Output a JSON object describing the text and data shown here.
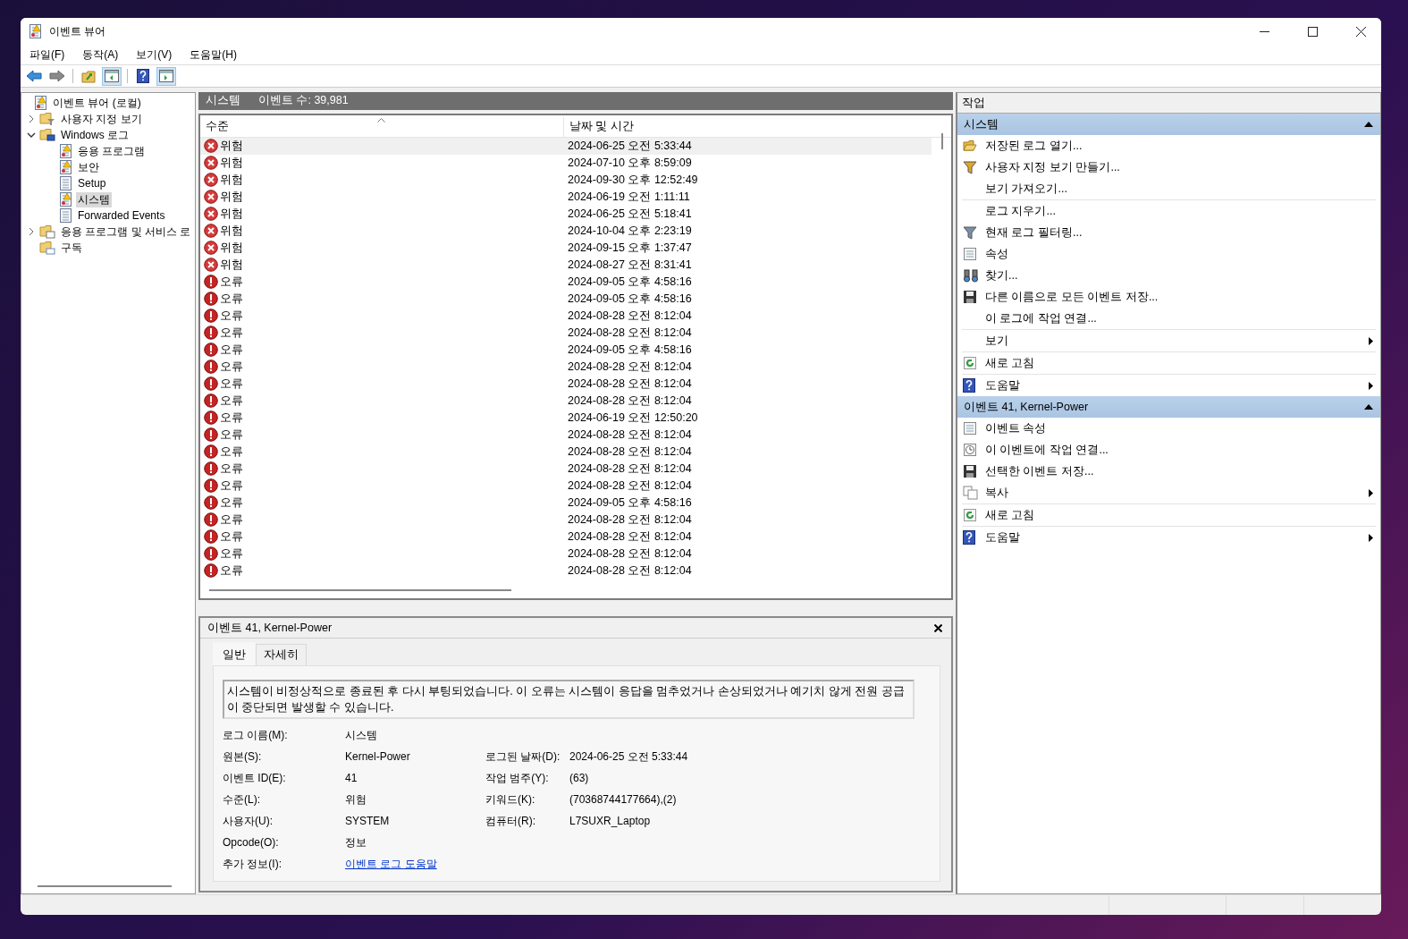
{
  "window": {
    "title": "이벤트 뷰어"
  },
  "menu": [
    "파일(F)",
    "동작(A)",
    "보기(V)",
    "도움말(H)"
  ],
  "toolbar": [
    {
      "kind": "back",
      "pressed": false
    },
    {
      "kind": "forward",
      "pressed": false
    },
    {
      "kind": "up",
      "pressed": false
    },
    {
      "kind": "tree",
      "pressed": true
    },
    {
      "kind": "help",
      "pressed": false
    },
    {
      "kind": "actions",
      "pressed": true
    }
  ],
  "tree": [
    {
      "label": "이벤트 뷰어 (로컬)",
      "kind": "root",
      "expandable": false,
      "selected": false,
      "children": [
        {
          "label": "사용자 지정 보기",
          "kind": "folder-filter",
          "expandable": true,
          "expanded": false,
          "selected": false
        },
        {
          "label": "Windows 로그",
          "kind": "folder-pc",
          "expandable": true,
          "expanded": true,
          "selected": false,
          "children": [
            {
              "label": "응용 프로그램",
              "kind": "log-alert",
              "expandable": false,
              "selected": false
            },
            {
              "label": "보안",
              "kind": "log-alert",
              "expandable": false,
              "selected": false
            },
            {
              "label": "Setup",
              "kind": "log",
              "expandable": false,
              "selected": false
            },
            {
              "label": "시스템",
              "kind": "log-alert",
              "expandable": false,
              "selected": true
            },
            {
              "label": "Forwarded Events",
              "kind": "log",
              "expandable": false,
              "selected": false
            }
          ]
        },
        {
          "label": "응용 프로그램 및 서비스 로",
          "kind": "folder-window",
          "expandable": true,
          "expanded": false,
          "selected": false
        },
        {
          "label": "구독",
          "kind": "folder-sub",
          "expandable": false,
          "selected": false
        }
      ]
    }
  ],
  "log_header": {
    "name": "시스템",
    "count": "이벤트 수: 39,981"
  },
  "table": {
    "columns": [
      "수준",
      "날짜 및 시간"
    ],
    "rows": [
      {
        "kind": "critical",
        "level": "위험",
        "date": "2024-06-25 오전 5:33:44",
        "selected": true
      },
      {
        "kind": "critical",
        "level": "위험",
        "date": "2024-07-10 오후 8:59:09",
        "selected": false
      },
      {
        "kind": "critical",
        "level": "위험",
        "date": "2024-09-30 오후 12:52:49",
        "selected": false
      },
      {
        "kind": "critical",
        "level": "위험",
        "date": "2024-06-19 오전 1:11:11",
        "selected": false
      },
      {
        "kind": "critical",
        "level": "위험",
        "date": "2024-06-25 오전 5:18:41",
        "selected": false
      },
      {
        "kind": "critical",
        "level": "위험",
        "date": "2024-10-04 오후 2:23:19",
        "selected": false
      },
      {
        "kind": "critical",
        "level": "위험",
        "date": "2024-09-15 오후 1:37:47",
        "selected": false
      },
      {
        "kind": "critical",
        "level": "위험",
        "date": "2024-08-27 오전 8:31:41",
        "selected": false
      },
      {
        "kind": "error",
        "level": "오류",
        "date": "2024-09-05 오후 4:58:16",
        "selected": false
      },
      {
        "kind": "error",
        "level": "오류",
        "date": "2024-09-05 오후 4:58:16",
        "selected": false
      },
      {
        "kind": "error",
        "level": "오류",
        "date": "2024-08-28 오전 8:12:04",
        "selected": false
      },
      {
        "kind": "error",
        "level": "오류",
        "date": "2024-08-28 오전 8:12:04",
        "selected": false
      },
      {
        "kind": "error",
        "level": "오류",
        "date": "2024-09-05 오후 4:58:16",
        "selected": false
      },
      {
        "kind": "error",
        "level": "오류",
        "date": "2024-08-28 오전 8:12:04",
        "selected": false
      },
      {
        "kind": "error",
        "level": "오류",
        "date": "2024-08-28 오전 8:12:04",
        "selected": false
      },
      {
        "kind": "error",
        "level": "오류",
        "date": "2024-08-28 오전 8:12:04",
        "selected": false
      },
      {
        "kind": "error",
        "level": "오류",
        "date": "2024-06-19 오전 12:50:20",
        "selected": false
      },
      {
        "kind": "error",
        "level": "오류",
        "date": "2024-08-28 오전 8:12:04",
        "selected": false
      },
      {
        "kind": "error",
        "level": "오류",
        "date": "2024-08-28 오전 8:12:04",
        "selected": false
      },
      {
        "kind": "error",
        "level": "오류",
        "date": "2024-08-28 오전 8:12:04",
        "selected": false
      },
      {
        "kind": "error",
        "level": "오류",
        "date": "2024-08-28 오전 8:12:04",
        "selected": false
      },
      {
        "kind": "error",
        "level": "오류",
        "date": "2024-09-05 오후 4:58:16",
        "selected": false
      },
      {
        "kind": "error",
        "level": "오류",
        "date": "2024-08-28 오전 8:12:04",
        "selected": false
      },
      {
        "kind": "error",
        "level": "오류",
        "date": "2024-08-28 오전 8:12:04",
        "selected": false
      },
      {
        "kind": "error",
        "level": "오류",
        "date": "2024-08-28 오전 8:12:04",
        "selected": false
      },
      {
        "kind": "error",
        "level": "오류",
        "date": "2024-08-28 오전 8:12:04",
        "selected": false
      }
    ]
  },
  "detail": {
    "title": "이벤트 41, Kernel-Power",
    "tabs": [
      {
        "label": "일반",
        "selected": true
      },
      {
        "label": "자세히",
        "selected": false
      }
    ],
    "description": "시스템이 비정상적으로 종료된 후 다시 부팅되었습니다. 이 오류는 시스템이 응답을 멈추었거나 손상되었거나 예기치 않게 전원 공급이 중단되면 발생할 수 있습니다.",
    "rows": [
      {
        "left": {
          "label": "로그 이름(M):",
          "value": "시스템"
        }
      },
      {
        "left": {
          "label": "원본(S):",
          "value": "Kernel-Power"
        },
        "right": {
          "label": "로그된 날짜(D):",
          "value": "2024-06-25 오전 5:33:44"
        }
      },
      {
        "left": {
          "label": "이벤트 ID(E):",
          "value": "41"
        },
        "right": {
          "label": "작업 범주(Y):",
          "value": "(63)"
        }
      },
      {
        "left": {
          "label": "수준(L):",
          "value": "위험"
        },
        "right": {
          "label": "키워드(K):",
          "value": "(70368744177664),(2)"
        }
      },
      {
        "left": {
          "label": "사용자(U):",
          "value": "SYSTEM"
        },
        "right": {
          "label": "컴퓨터(R):",
          "value": "L7SUXR_Laptop"
        }
      },
      {
        "left": {
          "label": "Opcode(O):",
          "value": "정보"
        }
      },
      {
        "left": {
          "label": "추가 정보(I):",
          "value": "이벤트 로그 도움말",
          "kind": "link"
        }
      }
    ]
  },
  "actions": {
    "title": "작업",
    "sections": [
      {
        "title": "시스템",
        "expanded": true,
        "groups": [
          [
            {
              "label": "저장된 로그 열기...",
              "kind": "open",
              "submenu": false
            },
            {
              "label": "사용자 지정 보기 만들기...",
              "kind": "filter-new",
              "submenu": false
            },
            {
              "label": "보기 가져오기...",
              "kind": "plain",
              "submenu": false
            }
          ],
          [
            {
              "label": "로그 지우기...",
              "kind": "plain",
              "submenu": false
            },
            {
              "label": "현재 로그 필터링...",
              "kind": "filter",
              "submenu": false
            },
            {
              "label": "속성",
              "kind": "properties",
              "submenu": false
            },
            {
              "label": "찾기...",
              "kind": "find",
              "submenu": false
            },
            {
              "label": "다른 이름으로 모든 이벤트 저장...",
              "kind": "save",
              "submenu": false
            },
            {
              "label": "이 로그에 작업 연결...",
              "kind": "plain",
              "submenu": false
            }
          ],
          [
            {
              "label": "보기",
              "kind": "plain",
              "submenu": true
            }
          ],
          [
            {
              "label": "새로 고침",
              "kind": "refresh",
              "submenu": false
            }
          ],
          [
            {
              "label": "도움말",
              "kind": "help",
              "submenu": true
            }
          ]
        ]
      },
      {
        "title": "이벤트 41, Kernel-Power",
        "expanded": true,
        "groups": [
          [
            {
              "label": "이벤트 속성",
              "kind": "properties",
              "submenu": false
            },
            {
              "label": "이 이벤트에 작업 연결...",
              "kind": "task",
              "submenu": false
            },
            {
              "label": "선택한 이벤트 저장...",
              "kind": "save",
              "submenu": false
            },
            {
              "label": "복사",
              "kind": "copy",
              "submenu": true
            }
          ],
          [
            {
              "label": "새로 고침",
              "kind": "refresh",
              "submenu": false
            }
          ],
          [
            {
              "label": "도움말",
              "kind": "help",
              "submenu": true
            }
          ]
        ]
      }
    ]
  }
}
